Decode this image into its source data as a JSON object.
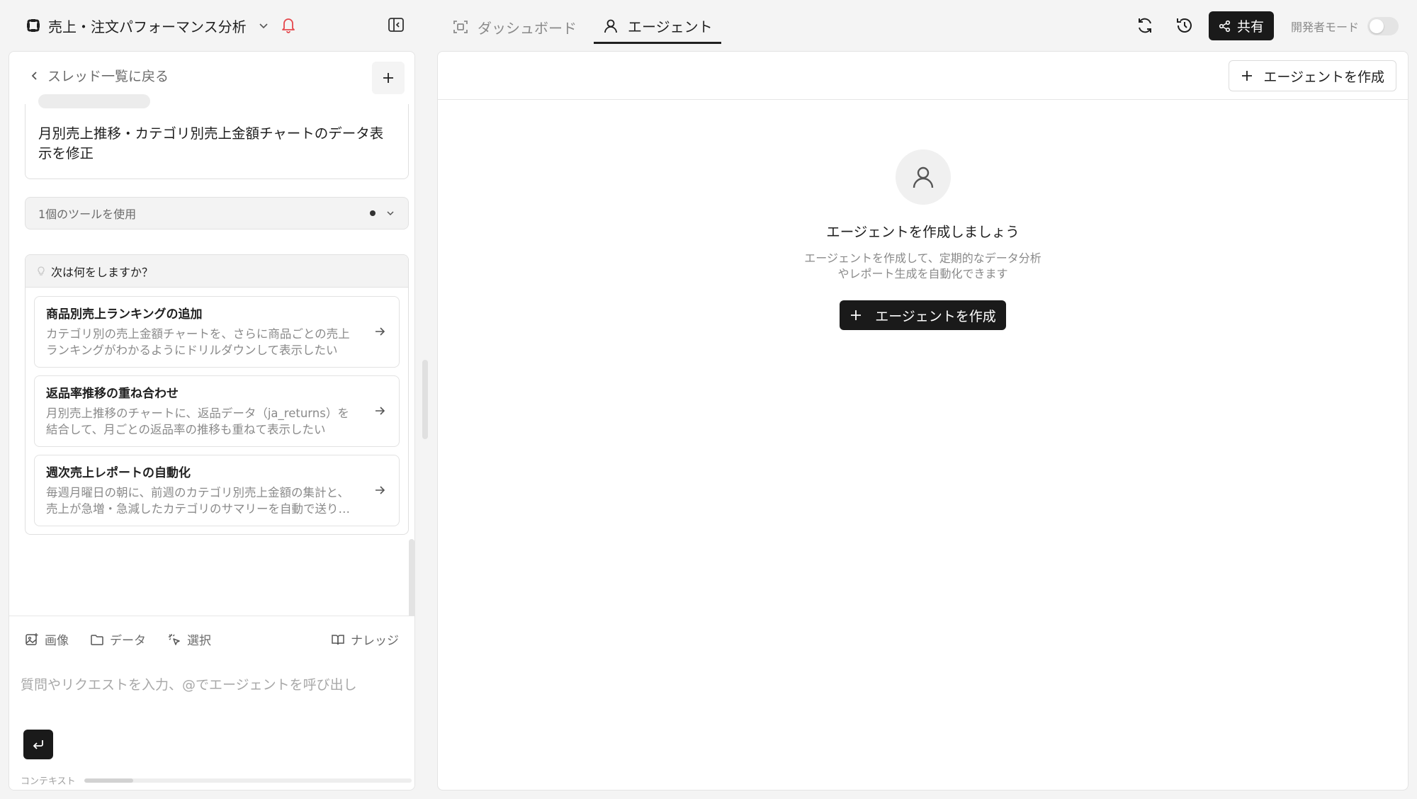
{
  "project": {
    "title": "売上・注文パフォーマンス分析"
  },
  "tabs": [
    {
      "label": "ダッシュボード",
      "icon": "scan-icon",
      "active": false
    },
    {
      "label": "エージェント",
      "icon": "user-icon",
      "active": true
    }
  ],
  "header": {
    "share_label": "共有",
    "dev_mode_label": "開発者モード",
    "dev_mode_on": false
  },
  "thread": {
    "back_label": "スレッド一覧に戻る",
    "message": "月別売上推移・カテゴリ別売上金額チャートのデータ表示を修正",
    "tools_used": "1個のツールを使用"
  },
  "next": {
    "heading": "次は何をしますか？",
    "suggestions": [
      {
        "title": "商品別売上ランキングの追加",
        "desc": "カテゴリ別の売上金額チャートを、さらに商品ごとの売上ランキングがわかるようにドリルダウンして表示したい"
      },
      {
        "title": "返品率推移の重ね合わせ",
        "desc": "月別売上推移のチャートに、返品データ（ja_returns）を結合して、月ごとの返品率の推移も重ねて表示したい"
      },
      {
        "title": "週次売上レポートの自動化",
        "desc": "毎週月曜日の朝に、前週のカテゴリ別売上金額の集計と、売上が急増・急減したカテゴリのサマリーを自動で送りたい"
      }
    ]
  },
  "composer": {
    "tools": {
      "image": "画像",
      "data": "データ",
      "select": "選択",
      "knowledge": "ナレッジ"
    },
    "placeholder": "質問やリクエストを入力、@でエージェントを呼び出し",
    "context_label": "コンテキスト",
    "context_usage": 0.15
  },
  "agents": {
    "create_label": "エージェントを作成",
    "empty_title": "エージェントを作成しましょう",
    "empty_desc": "エージェントを作成して、定期的なデータ分析やレポート生成を自動化できます"
  },
  "colors": {
    "accent_dark": "#1a1a1a",
    "bell": "#e5484d",
    "muted": "#8a8a8a"
  }
}
